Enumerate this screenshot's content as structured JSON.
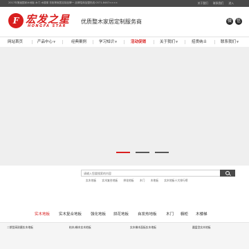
{
  "topbar": {
    "notice": "2017年第届国家木地板 木门 木楼梯 衣柜等家居定制品牌一 品牌招商加盟热线:0571-8467××××",
    "links": [
      "关于我们",
      "联系我们",
      "进入"
    ]
  },
  "header": {
    "logo_mark": "F",
    "logo_cn": "宏发之星",
    "logo_en": "HONGFA STAR",
    "slogan": "优质整木家居定制服务商",
    "social_icons": [
      "weibo-icon",
      "wechat-icon"
    ],
    "social_glyphs": [
      "微",
      "信"
    ]
  },
  "nav": {
    "items": [
      {
        "label": "网站首页",
        "has_arrow": false
      },
      {
        "label": "产品中心",
        "has_arrow": true
      },
      {
        "label": "经典案例",
        "has_arrow": false
      },
      {
        "label": "学习知识",
        "has_arrow": true
      },
      {
        "label": "活动促销",
        "has_arrow": false,
        "active": true
      },
      {
        "label": "关于我们",
        "has_arrow": true
      },
      {
        "label": "招贤纳士",
        "has_arrow": false
      },
      {
        "label": "联系我们",
        "has_arrow": true
      }
    ],
    "arrow_glyph": "▼"
  },
  "banner": {
    "slides": 3,
    "active_slide": 1
  },
  "search": {
    "placeholder": "请输入您要搜索的内容"
  },
  "hotwords": [
    "实木地板",
    "实木复合地板",
    "拼花地板",
    "木门",
    "木地板",
    "实木地板十大排行榜"
  ],
  "categories": {
    "items": [
      "实木地板",
      "实木复合地板",
      "强化地板",
      "拼花地板",
      "自发热地板",
      "木门",
      "橱柜",
      "木楼梯"
    ],
    "active_index": 0
  },
  "products": [
    "二期型高耐磨实木地板",
    "柏木/橡木实木地板",
    "实木橡木面板实木地板",
    "圆盘型实木地板"
  ],
  "colors": {
    "brand_red": "#d81e1e",
    "topbar_bg": "#4a4a4a",
    "banner_bg": "#efefef"
  }
}
